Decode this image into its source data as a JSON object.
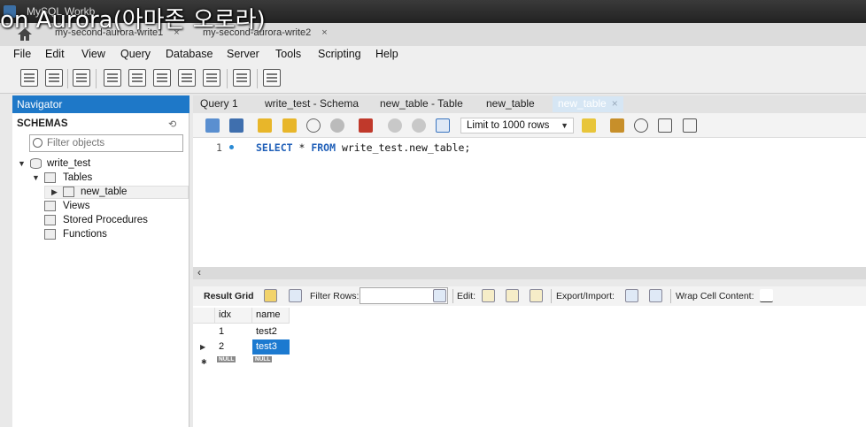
{
  "window": {
    "app_title": "MySQL Workb",
    "overlay_caption": "on Aurora(아마존 오로라)"
  },
  "connection_tabs": [
    {
      "label": "my-second-aurora-write1",
      "close": "×"
    },
    {
      "label": "my-second-aurora-write2",
      "close": "×"
    }
  ],
  "menu": [
    "File",
    "Edit",
    "View",
    "Query",
    "Database",
    "Server",
    "Tools",
    "Scripting",
    "Help"
  ],
  "navigator": {
    "header": "Navigator",
    "schemas_label": "SCHEMAS",
    "filter_placeholder": "Filter objects",
    "tree": {
      "schema": "write_test",
      "tables": "Tables",
      "table": "new_table",
      "views": "Views",
      "stored_procedures": "Stored Procedures",
      "functions": "Functions"
    }
  },
  "editor_tabs": [
    {
      "label": "Query 1"
    },
    {
      "label": "write_test - Schema"
    },
    {
      "label": "new_table - Table"
    },
    {
      "label": "new_table"
    },
    {
      "label": "new_table",
      "active": true,
      "close": "×"
    }
  ],
  "query_toolbar": {
    "limit_value": "Limit to 1000 rows"
  },
  "editor": {
    "line_number": "1",
    "sql_keyword_select": "SELECT",
    "sql_star": " * ",
    "sql_keyword_from": "FROM",
    "sql_rest": " write_test.new_table;"
  },
  "result_toolbar": {
    "result_grid": "Result Grid",
    "filter_rows": "Filter Rows:",
    "edit": "Edit:",
    "export_import": "Export/Import:",
    "wrap_cell": "Wrap Cell Content:"
  },
  "grid": {
    "columns": [
      "idx",
      "name"
    ],
    "rows": [
      {
        "idx": "1",
        "name": "test2"
      },
      {
        "idx": "2",
        "name": "test3"
      }
    ],
    "null_label": "NULL"
  },
  "colors": {
    "navigator_header": "#1e78c8",
    "selection": "#1c7ad0",
    "sql_keyword": "#1f5fb8"
  }
}
